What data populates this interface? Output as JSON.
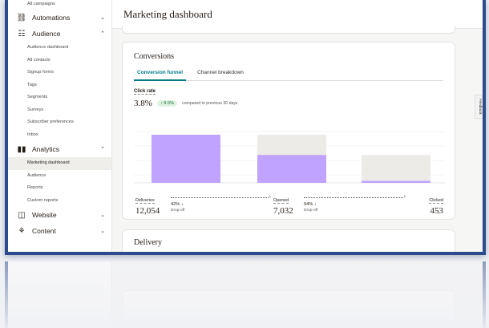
{
  "sidebar": {
    "top_item": "All campaigns",
    "automations": "Automations",
    "audience": "Audience",
    "audience_items": [
      "Audience dashboard",
      "All contacts",
      "Signup forms",
      "Tags",
      "Segments",
      "Surveys",
      "Subscriber preferences",
      "Inbox"
    ],
    "analytics": "Analytics",
    "analytics_items": [
      "Marketing dashboard",
      "Audience",
      "Reports",
      "Custom reports"
    ],
    "website": "Website",
    "content": "Content"
  },
  "header": {
    "title": "Marketing dashboard"
  },
  "conversions": {
    "title": "Conversions",
    "tabs": [
      "Conversion funnel",
      "Channel breakdown"
    ],
    "metric_label": "Click rate",
    "metric_value": "3.8%",
    "delta": "↑ 9.5%",
    "compare_text": "compared to previous 30 days"
  },
  "funnel": {
    "stages": [
      {
        "name": "Deliveries",
        "value": "12,054"
      },
      {
        "name": "Opened",
        "value": "7,032"
      },
      {
        "name": "Clicked",
        "value": "453"
      }
    ],
    "dropoffs": [
      {
        "pct": "42% ↓",
        "label": "Drop-off"
      },
      {
        "pct": "94% ↓",
        "label": "Drop-off"
      }
    ],
    "fill_fraction": [
      1.0,
      0.58,
      0.04
    ],
    "colors": {
      "bar": "#c0a3ff",
      "remainder": "#ecebe7",
      "accent": "#007c89"
    }
  },
  "delivery": {
    "title": "Delivery"
  },
  "feedback": "Feedback",
  "icons": [
    "automations-icon",
    "audience-icon",
    "analytics-icon",
    "website-icon",
    "content-icon"
  ]
}
